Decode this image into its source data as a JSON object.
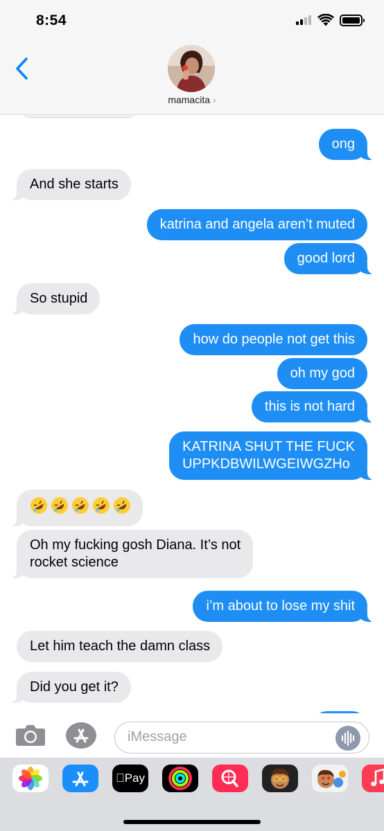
{
  "status_bar": {
    "time": "8:54"
  },
  "header": {
    "contact_name": "mamacita",
    "chevron": "›"
  },
  "messages": [
    {
      "dir": "out",
      "text": "ong"
    },
    {
      "dir": "in",
      "text": "And she starts"
    },
    {
      "dir": "out",
      "text": "katrina and angela aren’t muted"
    },
    {
      "dir": "out",
      "text": "good lord"
    },
    {
      "dir": "in",
      "text": "So stupid"
    },
    {
      "dir": "out",
      "text": "how do people not get this"
    },
    {
      "dir": "out",
      "text": "oh my god"
    },
    {
      "dir": "out",
      "text": "this is not hard"
    },
    {
      "dir": "out",
      "text_line1": "KATRINA SHUT THE FUCK",
      "text_line2": "UPPKDBWILWGEIWGZHo"
    },
    {
      "dir": "in",
      "emoji": "rolling-on-floor-laughing",
      "count": 5
    },
    {
      "dir": "in",
      "text_line1": "Oh my fucking gosh Diana. It’s not",
      "text_line2": "rocket science"
    },
    {
      "dir": "out",
      "text": "i’m about to lose my shit"
    },
    {
      "dir": "in",
      "text": "Let him teach the damn class"
    },
    {
      "dir": "in",
      "text": "Did you get it?"
    }
  ],
  "composer": {
    "placeholder": "iMessage"
  },
  "app_drawer": {
    "apps": [
      "photos-icon",
      "app-store-icon",
      "apple-pay-icon",
      "activity-icon",
      "search-web-icon",
      "memoji-icon",
      "memoji-stickers-icon",
      "music-icon"
    ],
    "apple_pay_label": "Pay"
  },
  "colors": {
    "outgoing": "#1e8ef5",
    "incoming": "#e9e9eb",
    "accent": "#0a84ff"
  }
}
